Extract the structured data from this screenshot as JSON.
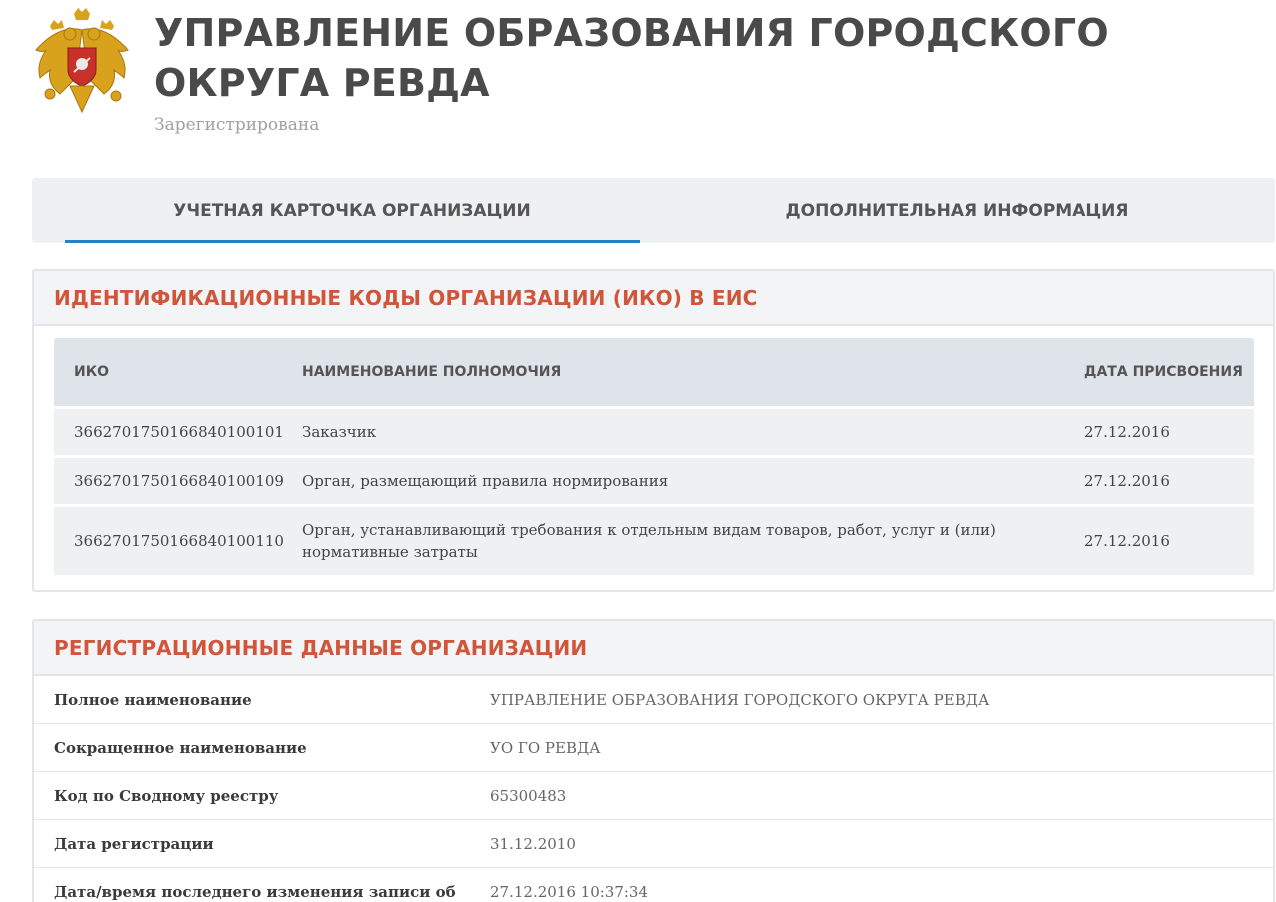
{
  "header": {
    "emblem_icon": "russian-coat-of-arms-icon",
    "title": "УПРАВЛЕНИЕ ОБРАЗОВАНИЯ ГОРОДСКОГО ОКРУГА РЕВДА",
    "status": "Зарегистрирована"
  },
  "tabs": [
    {
      "label": "УЧЕТНАЯ КАРТОЧКА ОРГАНИЗАЦИИ",
      "active": true
    },
    {
      "label": "ДОПОЛНИТЕЛЬНАЯ ИНФОРМАЦИЯ",
      "active": false
    }
  ],
  "colors": {
    "accent": "#2a7fc0",
    "section_title": "#d0553a",
    "title_text": "#4a4a4a",
    "muted_text": "#a0a0a0"
  },
  "iko_section": {
    "title": "ИДЕНТИФИКАЦИОННЫЕ КОДЫ ОРГАНИЗАЦИИ (ИКО) В ЕИС",
    "columns": [
      "ИКО",
      "НАИМЕНОВАНИЕ ПОЛНОМОЧИЯ",
      "ДАТА ПРИСВОЕНИЯ"
    ],
    "rows": [
      {
        "iko": "366270175016684010 0101",
        "authority": "Заказчик",
        "date": "27.12.2016"
      },
      {
        "iko": "366270175016684010 0109",
        "authority": "Орган, размещающий правила нормирования",
        "date": "27.12.2016"
      },
      {
        "iko": "366270175016684010 0110",
        "authority": "Орган, устанавливающий требования к отдельным видам товаров, работ, услуг и (или) нормативные затраты",
        "date": "27.12.2016"
      }
    ]
  },
  "registration_section": {
    "title": "РЕГИСТРАЦИОННЫЕ ДАННЫЕ ОРГАНИЗАЦИИ",
    "rows": [
      {
        "label": "Полное наименование",
        "value": "УПРАВЛЕНИЕ ОБРАЗОВАНИЯ ГОРОДСКОГО ОКРУГА РЕВДА"
      },
      {
        "label": "Сокращенное наименование",
        "value": "УО ГО РЕВДА"
      },
      {
        "label": "Код по Сводному реестру",
        "value": "65300483"
      },
      {
        "label": "Дата регистрации",
        "value": "31.12.2010"
      },
      {
        "label": "Дата/время последнего изменения записи об",
        "value": "27.12.2016 10:37:34"
      }
    ]
  }
}
